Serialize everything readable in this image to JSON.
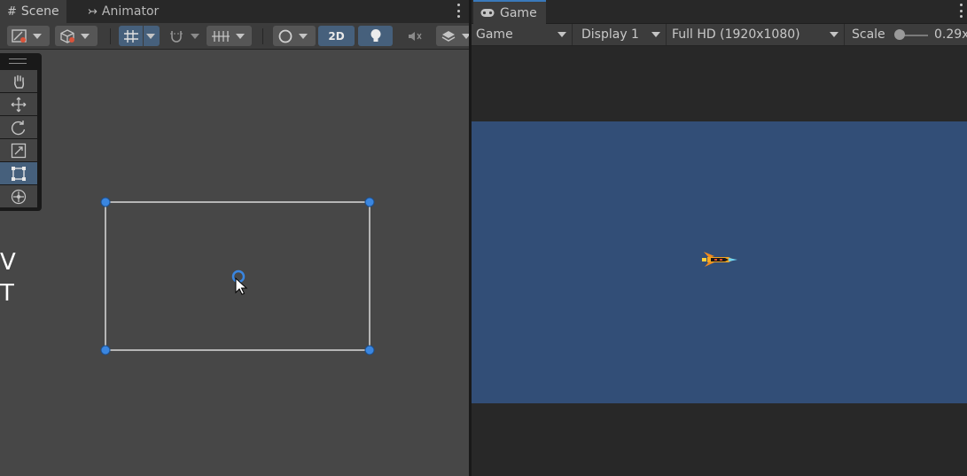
{
  "scene_tabs": {
    "scene_label": "Scene",
    "animator_label": "Animator"
  },
  "scene_toolbar": {
    "mode_2d_label": "2D"
  },
  "scene_view": {
    "side_letters": [
      "V",
      "T"
    ],
    "tools": [
      "hand-tool",
      "move-tool",
      "rotate-tool",
      "scale-tool",
      "rect-tool",
      "transform-tool"
    ],
    "active_tool": "rect-tool"
  },
  "game_tab": {
    "label": "Game"
  },
  "game_toolbar": {
    "view_mode": "Game",
    "display": "Display 1",
    "resolution": "Full HD (1920x1080)",
    "scale_label": "Scale",
    "scale_value": "0.29x"
  },
  "colors": {
    "accent": "#3a79bb",
    "selection_blue": "#46607c",
    "scene_background": "#474747",
    "game_camera_background": "#324e77",
    "handle_blue": "#3a86e0"
  }
}
